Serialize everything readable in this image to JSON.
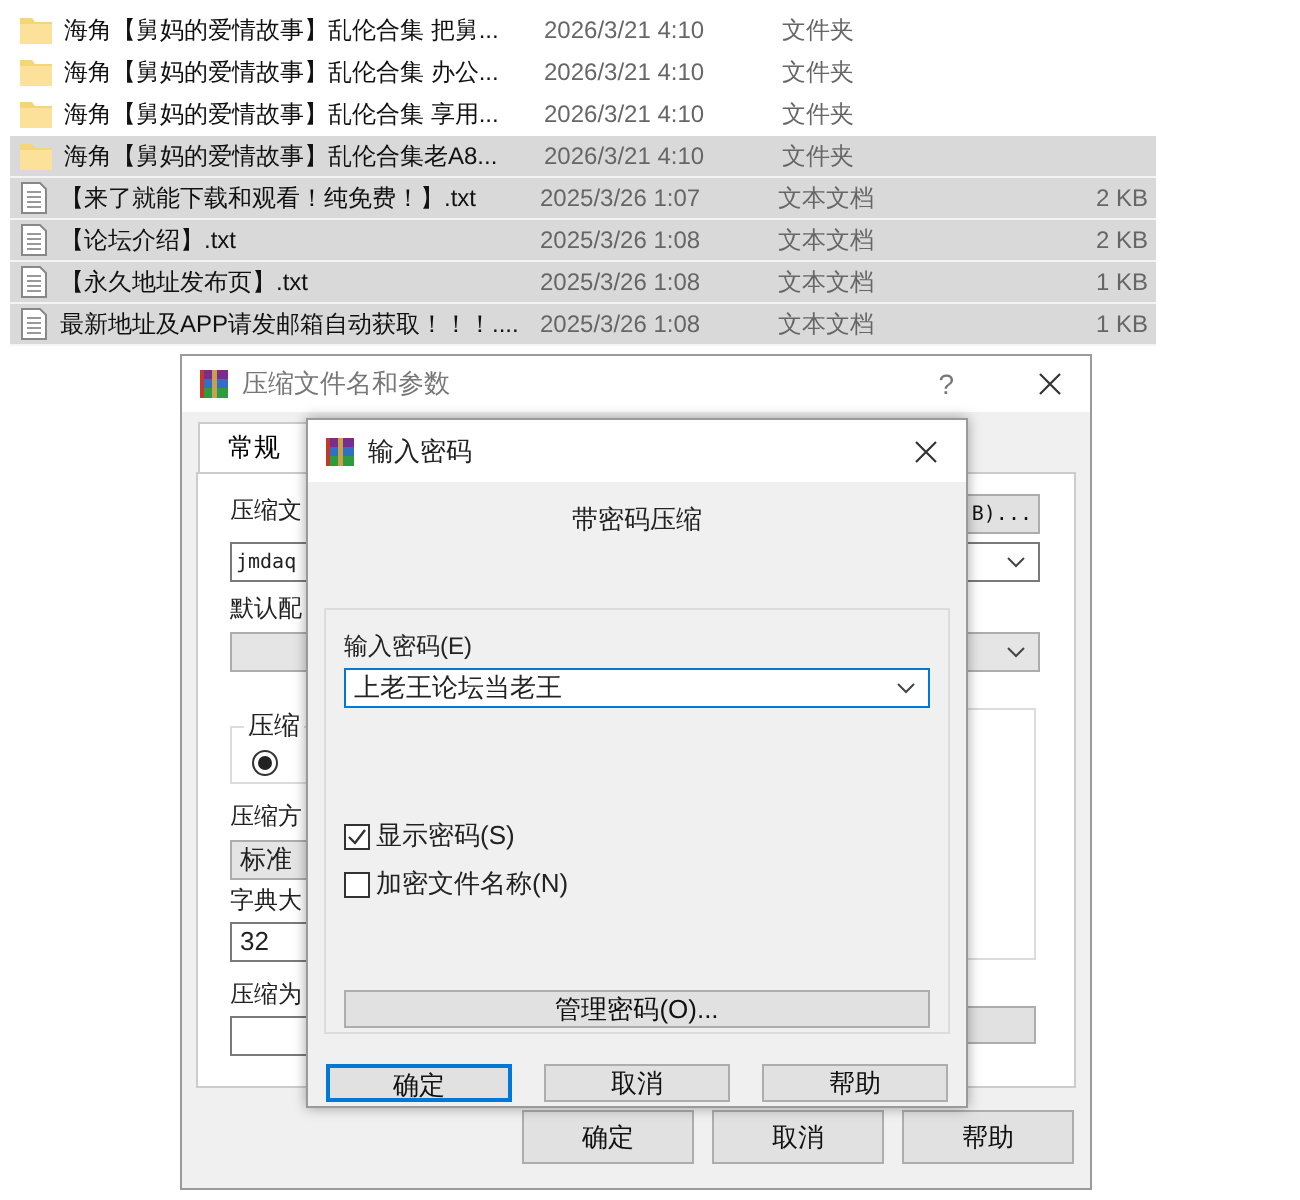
{
  "files": [
    {
      "kind": "folder",
      "name": "海角【舅妈的爱情故事】乱伦合集 把舅...",
      "date": "2026/3/21 4:10",
      "type": "文件夹",
      "selected": false
    },
    {
      "kind": "folder",
      "name": "海角【舅妈的爱情故事】乱伦合集 办公...",
      "date": "2026/3/21 4:10",
      "type": "文件夹",
      "selected": false
    },
    {
      "kind": "folder",
      "name": "海角【舅妈的爱情故事】乱伦合集 享用...",
      "date": "2026/3/21 4:10",
      "type": "文件夹",
      "selected": false
    },
    {
      "kind": "folder",
      "name": "海角【舅妈的爱情故事】乱伦合集老A8...",
      "date": "2026/3/21 4:10",
      "type": "文件夹",
      "selected": true
    },
    {
      "kind": "text",
      "name": "【来了就能下载和观看！纯免费！】.txt",
      "date": "2025/3/26 1:07",
      "type": "文本文档",
      "size": "2 KB",
      "selected": true
    },
    {
      "kind": "text",
      "name": "【论坛介绍】.txt",
      "date": "2025/3/26 1:08",
      "type": "文本文档",
      "size": "2 KB",
      "selected": true
    },
    {
      "kind": "text",
      "name": "【永久地址发布页】.txt",
      "date": "2025/3/26 1:08",
      "type": "文本文档",
      "size": "1 KB",
      "selected": true
    },
    {
      "kind": "text",
      "name": "最新地址及APP请发邮箱自动获取！！！....",
      "date": "2025/3/26 1:08",
      "type": "文本文档",
      "size": "1 KB",
      "selected": true
    }
  ],
  "archive_window": {
    "title": "压缩文件名和参数",
    "help": "?",
    "tabs": [
      {
        "label": "常规",
        "selected": true
      }
    ],
    "archive_name_label": "压缩文",
    "browse_button": "B)...",
    "archive_name": "jmdaq",
    "profile_label": "默认配",
    "format_group": "压缩",
    "format_radio_selected": true,
    "method_label": "压缩方",
    "method": "标准",
    "dictionary_label": "字典大",
    "dictionary": "32",
    "split_label": "压缩为",
    "buttons": [
      "确定",
      "取消",
      "帮助"
    ]
  },
  "password_dialog": {
    "title": "输入密码",
    "heading": "带密码压缩",
    "password_label": "输入密码(E)",
    "password": "上老王论坛当老王",
    "options": [
      {
        "label": "显示密码(S)",
        "checked": true
      },
      {
        "label": "加密文件名称(N)",
        "checked": false
      }
    ],
    "manage_button": "管理密码(O)...",
    "buttons": [
      "确定",
      "取消",
      "帮助"
    ]
  }
}
